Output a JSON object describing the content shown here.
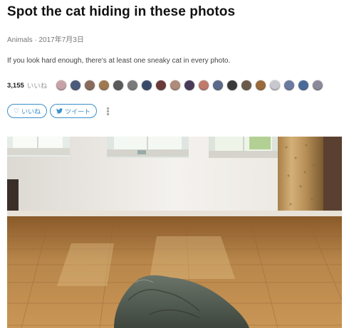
{
  "article": {
    "title": "Spot the cat hiding in these photos",
    "category": "Animals",
    "separator": " · ",
    "date": "2017年7月3日",
    "description": "If you look hard enough, there's at least one sneaky cat in every photo."
  },
  "likes": {
    "count": "3,155",
    "unit": "いいね",
    "avatar_colors": [
      "#c9a2a8",
      "#4a5a7a",
      "#8a6a5a",
      "#a07850",
      "#5a5a5a",
      "#7a7a7a",
      "#3a4a6a",
      "#6a3a3a",
      "#b08a7a",
      "#4a3a5a",
      "#c07a6a",
      "#5a6a8a",
      "#3a3a3a",
      "#6a5a4a",
      "#9a6a3a",
      "#c8c8d0",
      "#6a7aa0",
      "#4a6a9a",
      "#8a8a9a"
    ]
  },
  "actions": {
    "like_label": "いいね",
    "like_icon": "heart-outline-icon",
    "tweet_label": "ツイート",
    "tweet_icon": "twitter-bird-icon",
    "more_icon": "more-vertical-icon"
  },
  "photo": {
    "subject": "room-with-wooden-floor-and-windows"
  },
  "colors": {
    "accent": "#3a8fc9",
    "floor": "#b88548",
    "wall": "#f2f0ec",
    "curtain": "#c8a060"
  }
}
